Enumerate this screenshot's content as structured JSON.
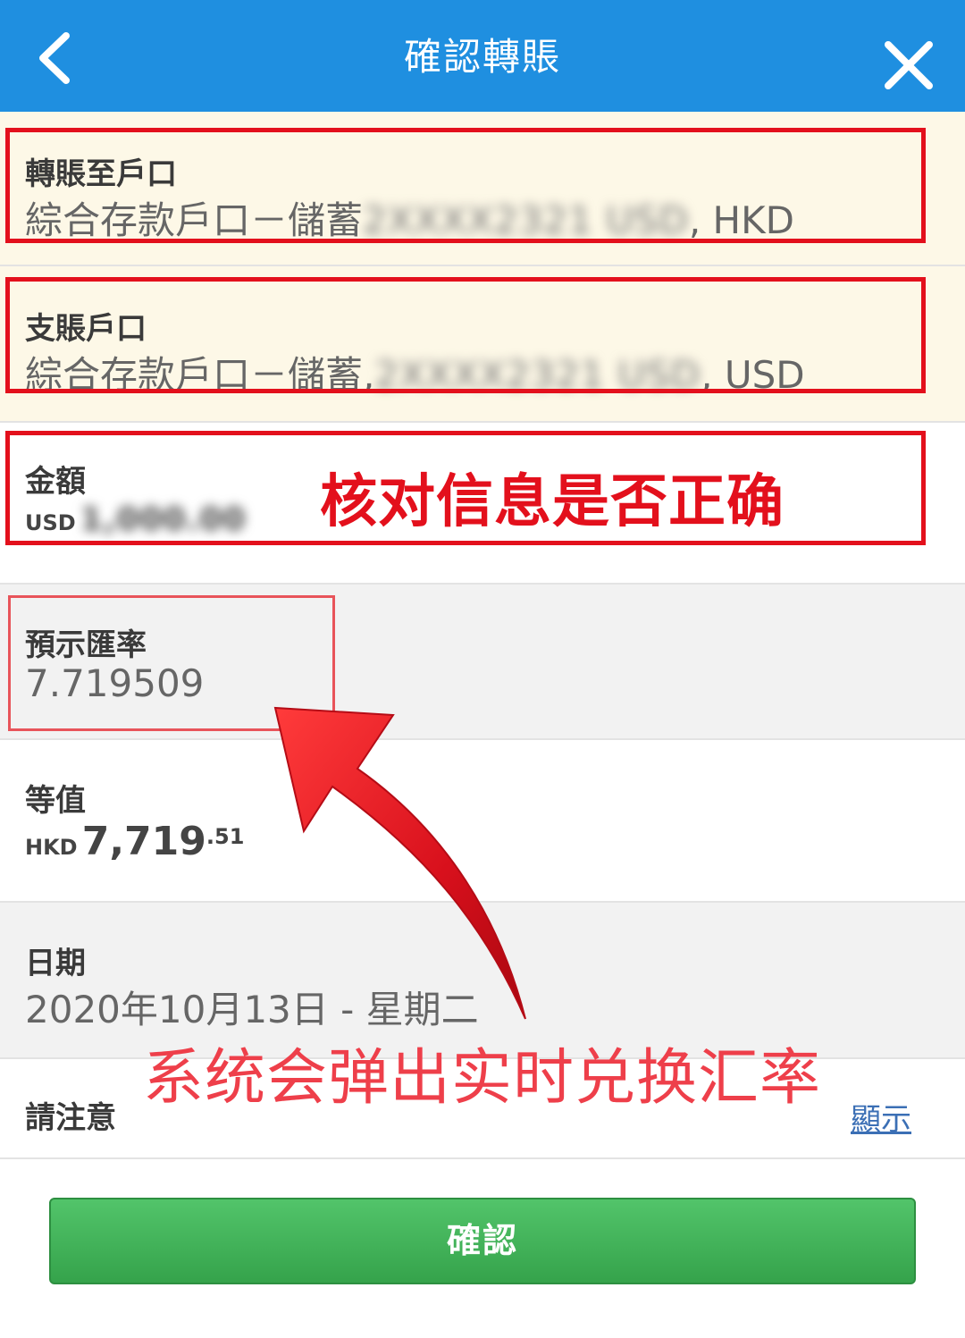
{
  "header": {
    "title": "確認轉賬",
    "back_icon": "chevron-left-icon",
    "close_icon": "close-icon",
    "background": "#1f8fe0"
  },
  "to_account": {
    "label": "轉賬至戶口",
    "value_prefix": "綜合存款戶口－儲蓄",
    "value_masked": "2XXXX2321 USD",
    "value_suffix": ", HKD"
  },
  "from_account": {
    "label": "支賬戶口",
    "value_prefix": "綜合存款戶口－儲蓄,",
    "value_masked": "2XXXX2321 USD",
    "value_suffix": ", USD"
  },
  "amount": {
    "label": "金額",
    "currency": "USD",
    "value_masked": "1,000.00"
  },
  "rate": {
    "label": "預示匯率",
    "value": "7.719509"
  },
  "equivalent": {
    "label": "等值",
    "currency": "HKD",
    "integer": "7,719",
    "decimal": ".51"
  },
  "date": {
    "label": "日期",
    "value": "2020年10月13日 - 星期二"
  },
  "notice": {
    "label": "請注意",
    "link": "顯示"
  },
  "confirm_button": {
    "label": "確認"
  },
  "annotations": {
    "check_info": "核对信息是否正确",
    "popup_rate": "系统会弹出实时兑换汇率",
    "color": "#e3101c"
  }
}
